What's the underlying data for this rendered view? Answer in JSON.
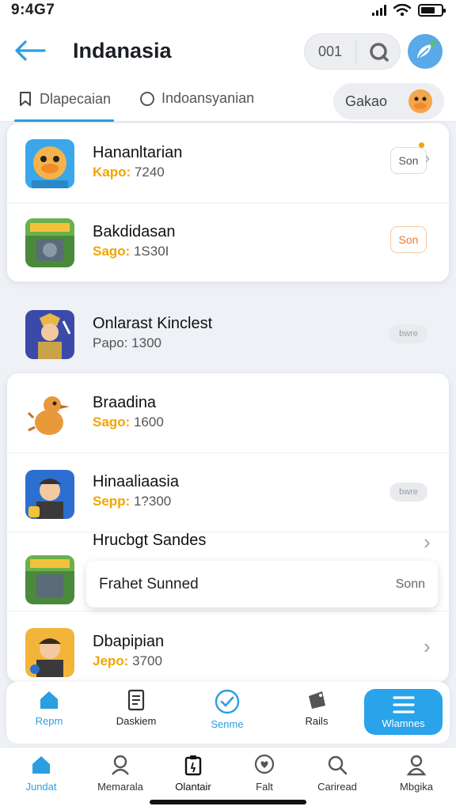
{
  "status": {
    "time": "9:4G7"
  },
  "header": {
    "title": "Indanasia",
    "counter": "001"
  },
  "tabs": {
    "active_label": "Dlapecaian",
    "second_label": "Indoansyanian",
    "pill_label": "Gakao"
  },
  "list": [
    {
      "title": "Hananltarian",
      "key": "Kapo:",
      "value": "7240",
      "action": "Son",
      "accent": "#2a9fe0"
    },
    {
      "title": "Bakdidasan",
      "key": "Sago:",
      "value": "1S30I",
      "action": "Son"
    },
    {
      "title": "Onlarast Kinclest",
      "key": "Papo:",
      "value": "1300",
      "action": "bwre"
    },
    {
      "title": "Braadina",
      "key": "Sago:",
      "value": "1600"
    },
    {
      "title": "Hinaaliaasia",
      "key": "Sepp:",
      "value": "1?300",
      "action": "bwre"
    },
    {
      "title": "Hrucbgt Sandes"
    },
    {
      "title": "Dbapipian",
      "key": "Jepo:",
      "value": "3700"
    }
  ],
  "popup": {
    "label": "Frahet Sunned",
    "action": "Sonn"
  },
  "toolbar": [
    {
      "label": "Repm",
      "icon": "home-icon"
    },
    {
      "label": "Daskiem",
      "icon": "document-icon"
    },
    {
      "label": "Senme",
      "icon": "check-circle-icon"
    },
    {
      "label": "Rails",
      "icon": "tag-icon"
    },
    {
      "label": "Wlamnes",
      "icon": "menu-icon"
    }
  ],
  "nav": [
    {
      "label": "Jundat",
      "icon": "home-icon"
    },
    {
      "label": "Memarala",
      "icon": "user-icon"
    },
    {
      "label": "Olantair",
      "icon": "clipboard-icon"
    },
    {
      "label": "Falt",
      "icon": "heart-pin-icon"
    },
    {
      "label": "Cariread",
      "icon": "search-icon"
    },
    {
      "label": "Mbgika",
      "icon": "profile-icon"
    }
  ],
  "colors": {
    "accent": "#2a9fe0",
    "orange": "#f0a500",
    "primary_button": "#29a3ea"
  }
}
